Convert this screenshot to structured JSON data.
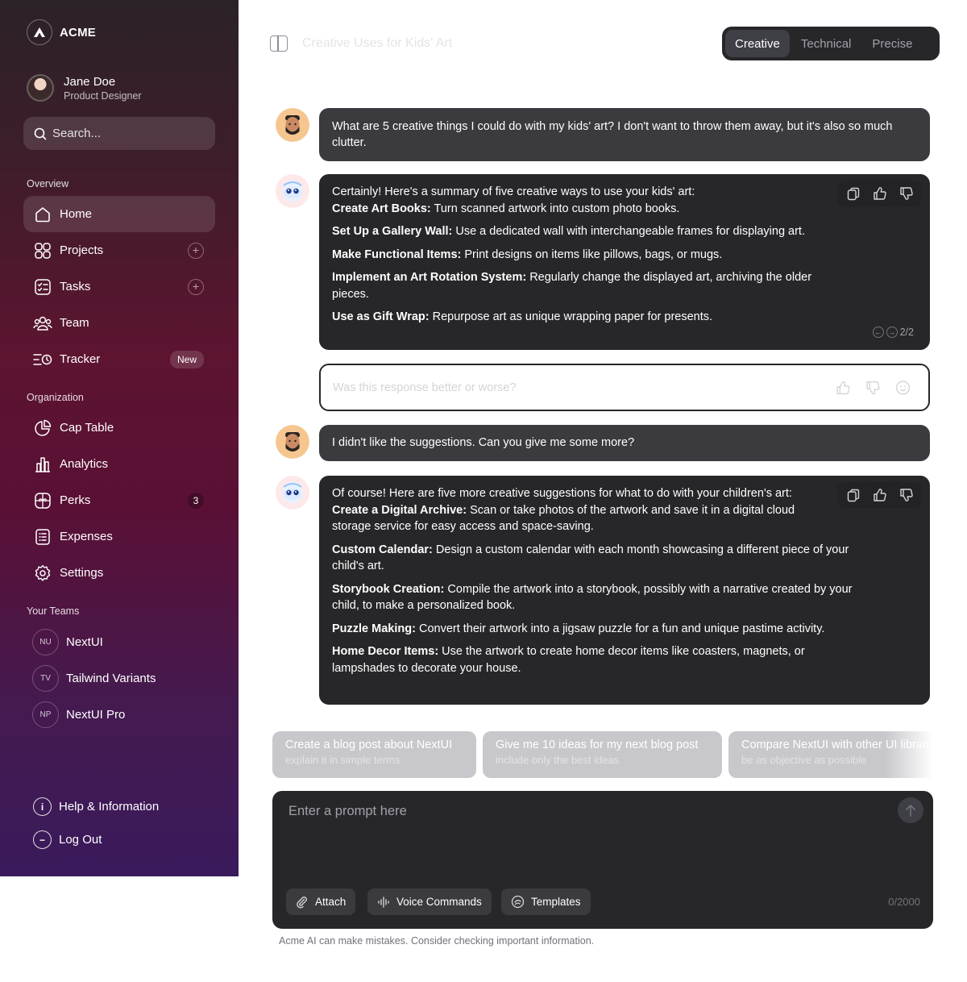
{
  "brand": {
    "name": "ACME"
  },
  "user": {
    "name": "Jane Doe",
    "role": "Product Designer"
  },
  "search": {
    "placeholder": "Search..."
  },
  "sections": {
    "overview": "Overview",
    "organization": "Organization",
    "teams": "Your Teams"
  },
  "nav": {
    "home": "Home",
    "projects": "Projects",
    "tasks": "Tasks",
    "team": "Team",
    "tracker": "Tracker",
    "tracker_badge": "New",
    "cap_table": "Cap Table",
    "analytics": "Analytics",
    "perks": "Perks",
    "perks_count": "3",
    "expenses": "Expenses",
    "settings": "Settings"
  },
  "teams": [
    {
      "initials": "NU",
      "name": "NextUI"
    },
    {
      "initials": "TV",
      "name": "Tailwind Variants"
    },
    {
      "initials": "NP",
      "name": "NextUI Pro"
    }
  ],
  "footer_nav": {
    "help": "Help & Information",
    "logout": "Log Out"
  },
  "header": {
    "title": "Creative Uses for Kids' Art"
  },
  "modes": {
    "creative": "Creative",
    "technical": "Technical",
    "precise": "Precise",
    "selected": "Creative"
  },
  "messages": {
    "m1": "What are 5 creative things I could do with my kids' art? I don't want to throw them away, but it's also so much clutter.",
    "m2": {
      "intro": "Certainly! Here's a summary of five creative ways to use your kids' art:",
      "items": [
        {
          "b": "Create Art Books:",
          "t": " Turn scanned artwork into custom photo books."
        },
        {
          "b": "Set Up a Gallery Wall:",
          "t": " Use a dedicated wall with interchangeable frames for displaying art."
        },
        {
          "b": "Make Functional Items:",
          "t": " Print designs on items like pillows, bags, or mugs."
        },
        {
          "b": "Implement an Art Rotation System:",
          "t": " Regularly change the displayed art, archiving the older pieces."
        },
        {
          "b": "Use as Gift Wrap:",
          "t": " Repurpose art as unique wrapping paper for presents."
        }
      ],
      "pager": "2/2"
    },
    "feedback_placeholder": "Was this response better or worse?",
    "m3": "I didn't like the suggestions. Can you give me some more?",
    "m4": {
      "intro": "Of course! Here are five more creative suggestions for what to do with your children's art:",
      "items": [
        {
          "b": "Create a Digital Archive:",
          "t": " Scan or take photos of the artwork and save it in a digital cloud storage service for easy access and space-saving."
        },
        {
          "b": "Custom Calendar:",
          "t": " Design a custom calendar with each month showcasing a different piece of your child's art."
        },
        {
          "b": "Storybook Creation:",
          "t": " Compile the artwork into a storybook, possibly with a narrative created by your child, to make a personalized book."
        },
        {
          "b": "Puzzle Making:",
          "t": " Convert their artwork into a jigsaw puzzle for a fun and unique pastime activity."
        },
        {
          "b": "Home Decor Items:",
          "t": " Use the artwork to create home decor items like coasters, magnets, or lampshades to decorate your house."
        }
      ]
    }
  },
  "suggestions": [
    {
      "title": "Create a blog post about NextUI",
      "sub": "explain it in simple terms"
    },
    {
      "title": "Give me 10 ideas for my next blog post",
      "sub": "include only the best ideas"
    },
    {
      "title": "Compare NextUI with other UI libraries",
      "sub": "be as objective as possible"
    }
  ],
  "composer": {
    "placeholder": "Enter a prompt here",
    "attach": "Attach",
    "voice": "Voice Commands",
    "templates": "Templates",
    "count": "0/2000"
  },
  "disclaimer": "Acme AI can make mistakes. Consider checking important information."
}
